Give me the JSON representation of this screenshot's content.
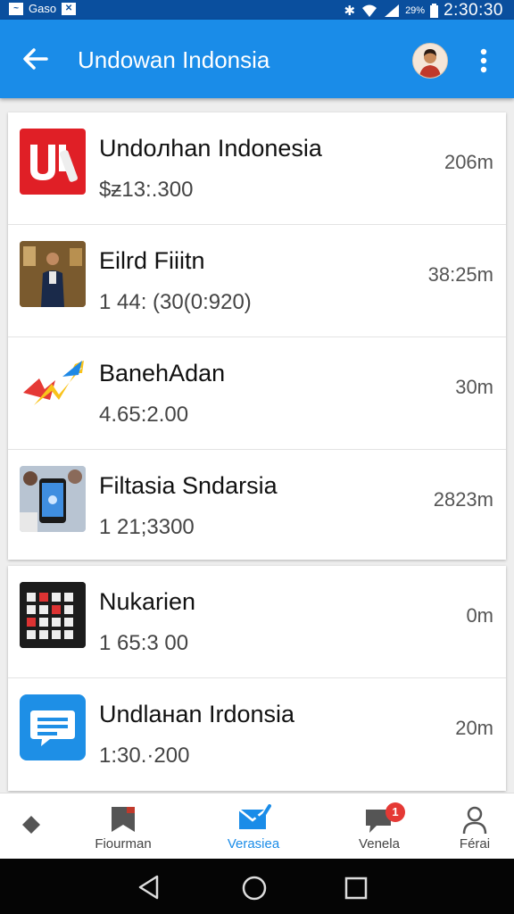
{
  "status_bar": {
    "left_text": "Gaso",
    "battery_text": "29%",
    "time": "2:30:30",
    "icons": [
      "notification-icon",
      "bluetooth-icon",
      "wifi-icon",
      "signal-icon",
      "battery-icon"
    ]
  },
  "app_bar": {
    "title": "Undowan Indonsia",
    "back_icon": "arrow-left-icon",
    "menu_icon": "more-vert-icon"
  },
  "list_groups": [
    {
      "items": [
        {
          "name": "Undoлhan Indonesia",
          "subtitle": "$ƶ13:.300",
          "time": "206m",
          "icon": "ui-logo-icon"
        },
        {
          "name": "Eilrd Fiiitn",
          "subtitle": "1 44: (30(0:920)",
          "time": "38:25m",
          "icon": "person-photo-icon"
        },
        {
          "name": "BanehAdan",
          "subtitle": "4.65:2.00",
          "time": "30m",
          "icon": "colorful-logo-icon"
        },
        {
          "name": "Filtasia Sndarsia",
          "subtitle": "1 21;3300",
          "time": "2823m",
          "icon": "phone-photo-icon"
        }
      ]
    },
    {
      "items": [
        {
          "name": "Nukarien",
          "subtitle": "1 65:3 00",
          "time": "0m",
          "icon": "keypad-icon"
        },
        {
          "name": "Undlaнan Irdonsia",
          "subtitle": "1:30.·200",
          "time": "20m",
          "icon": "chat-bubble-icon"
        }
      ]
    }
  ],
  "bottom_nav": [
    {
      "label": "",
      "icon": "diamond-icon"
    },
    {
      "label": "Fiourman",
      "icon": "bookmark-icon"
    },
    {
      "label": "Verasiea",
      "icon": "mail-check-icon",
      "active": true
    },
    {
      "label": "Venela",
      "icon": "chat-icon",
      "badge": "1"
    },
    {
      "label": "Férai",
      "icon": "person-icon"
    }
  ],
  "colors": {
    "app_bar": "#1a8ce8",
    "status_bar": "#0a4f9e",
    "active": "#1a8ce8",
    "badge": "#e53935"
  }
}
